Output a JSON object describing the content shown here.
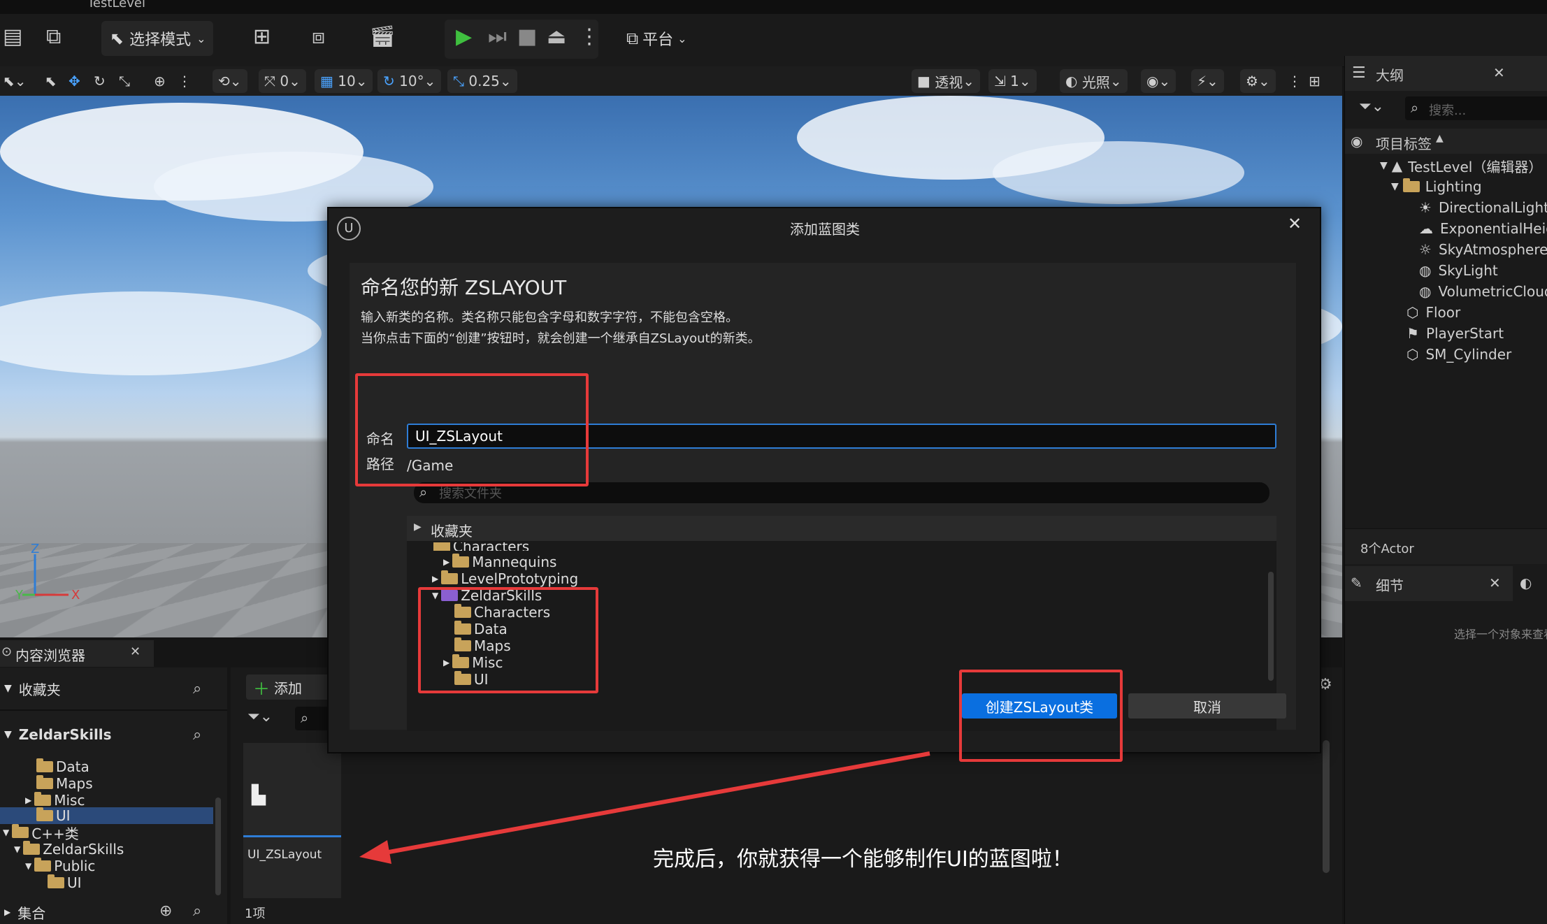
{
  "app": {
    "level_tab": "TestLevel"
  },
  "toolbar": {
    "mode_label": "选择模式",
    "platform_label": "平台"
  },
  "viewport_toolbar": {
    "rotate_val": "0",
    "grid_val": "10",
    "angle_val": "10°",
    "scale_val": "0.25",
    "view_mode": "透视",
    "cam_speed": "1",
    "lighting_label": "光照"
  },
  "outliner": {
    "tab_title": "大纲",
    "search_placeholder": "搜索...",
    "column_label": "项目标签",
    "items": [
      {
        "label": "TestLevel（编辑器）"
      },
      {
        "label": "Lighting"
      },
      {
        "label": "DirectionalLight"
      },
      {
        "label": "ExponentialHeig"
      },
      {
        "label": "SkyAtmosphere"
      },
      {
        "label": "SkyLight"
      },
      {
        "label": "VolumetricCloud"
      },
      {
        "label": "Floor"
      },
      {
        "label": "PlayerStart"
      },
      {
        "label": "SM_Cylinder"
      }
    ],
    "actor_count": "8个Actor",
    "details_tab": "细节",
    "details_hint": "选择一个对象来查看"
  },
  "content_browser": {
    "tab_title": "内容浏览器",
    "favorites": "收藏夹",
    "root": "ZeldarSkills",
    "add_label": "添加",
    "tree": [
      {
        "label": "Data"
      },
      {
        "label": "Maps"
      },
      {
        "label": "Misc"
      },
      {
        "label": "UI"
      },
      {
        "label": "C++类"
      },
      {
        "label": "ZeldarSkills"
      },
      {
        "label": "Public"
      },
      {
        "label": "UI"
      }
    ],
    "collections": "集合",
    "asset_name": "UI_ZSLayout",
    "item_count": "1项"
  },
  "dialog": {
    "title": "添加蓝图类",
    "heading": "命名您的新 ZSLAYOUT",
    "desc_line1": "输入新类的名称。类名称只能包含字母和数字字符，不能包含空格。",
    "desc_line2": "当你点击下面的“创建”按钮时，就会创建一个继承自ZSLayout的新类。",
    "name_label": "命名",
    "name_value": "UI_ZSLayout",
    "path_label": "路径",
    "path_value": "/Game",
    "folder_search_placeholder": "搜索文件夹",
    "favorites": "收藏夹",
    "tree": [
      {
        "label": "Characters"
      },
      {
        "label": "Mannequins"
      },
      {
        "label": "LevelPrototyping"
      },
      {
        "label": "ZeldarSkills"
      },
      {
        "label": "Characters"
      },
      {
        "label": "Data"
      },
      {
        "label": "Maps"
      },
      {
        "label": "Misc"
      },
      {
        "label": "UI"
      }
    ],
    "create_button": "创建ZSLayout类",
    "cancel_button": "取消"
  },
  "annotation": {
    "caption": "完成后，你就获得一个能够制作UI的蓝图啦！"
  },
  "colors": {
    "highlight_red": "#e63a3a",
    "primary_blue": "#0a6fe0",
    "play_green": "#3fbf3f"
  }
}
